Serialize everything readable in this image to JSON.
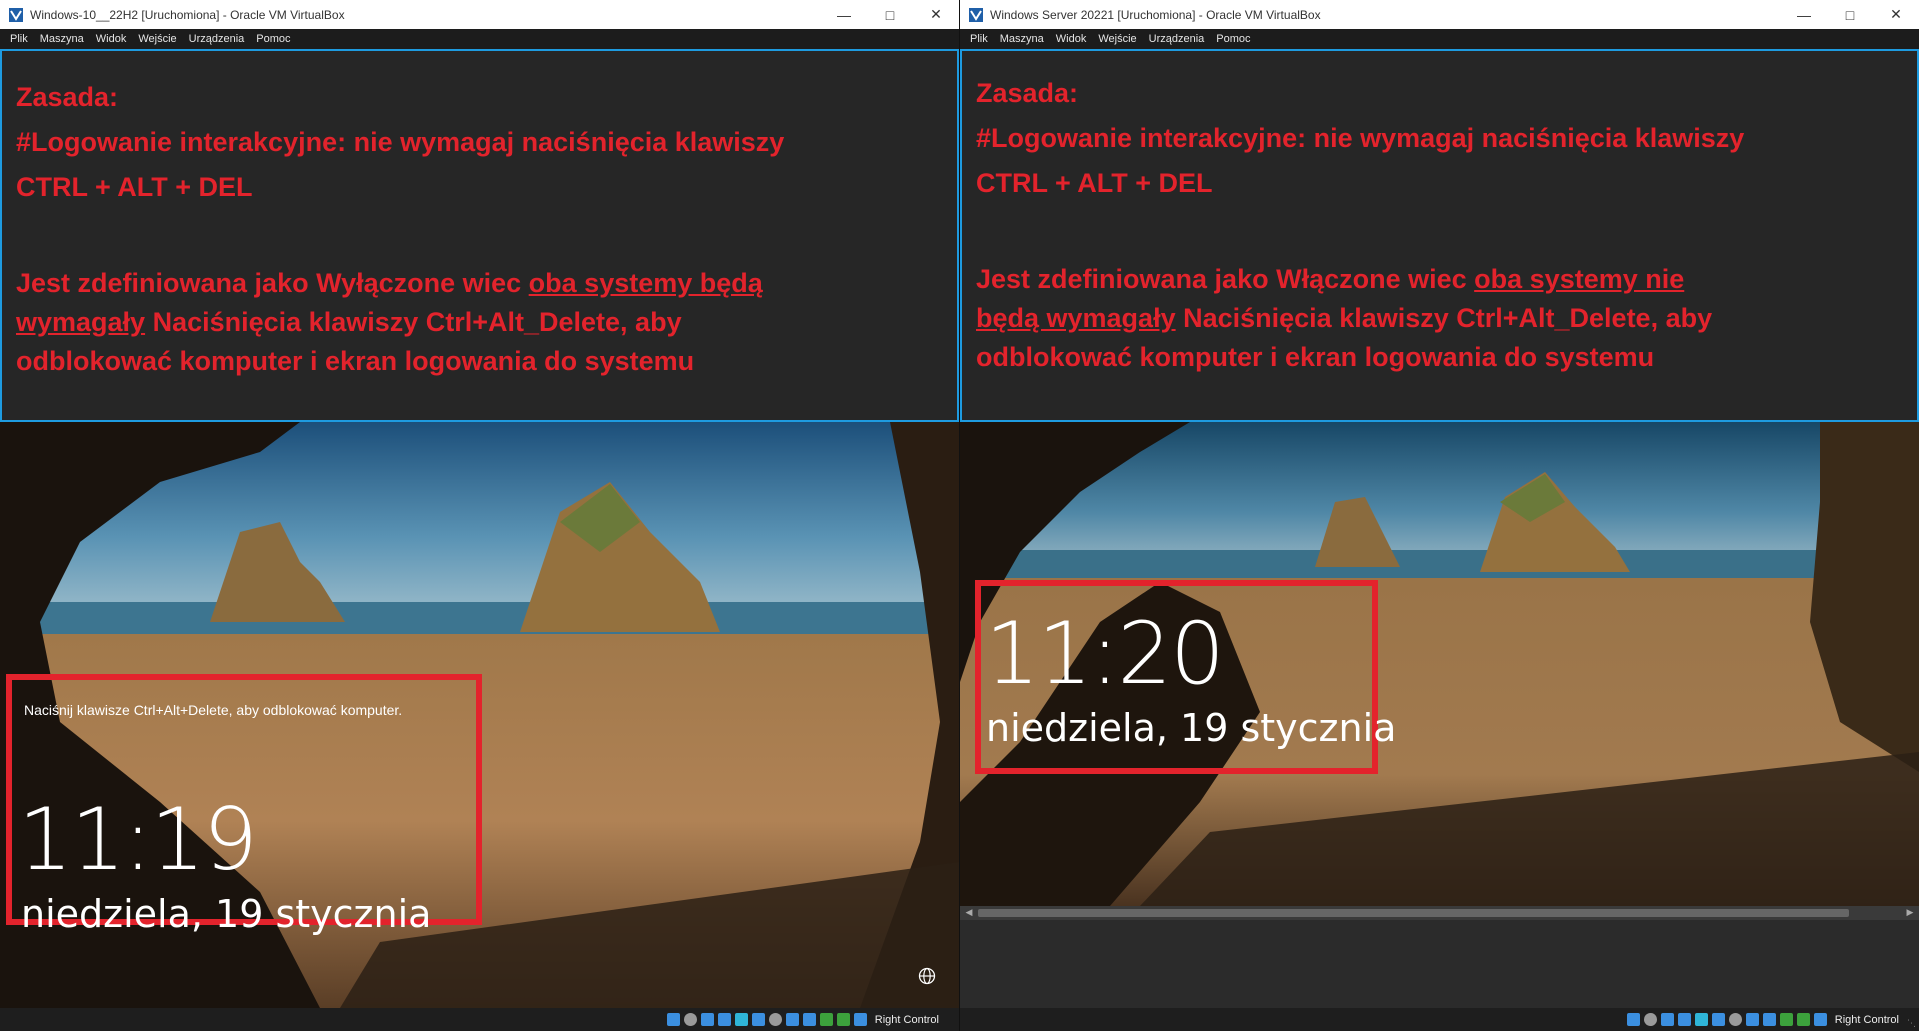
{
  "left": {
    "title": "Windows-10__22H2 [Uruchomiona] - Oracle VM VirtualBox",
    "menu": [
      "Plik",
      "Maszyna",
      "Widok",
      "Wejście",
      "Urządzenia",
      "Pomoc"
    ],
    "note": {
      "line1": "Zasada:",
      "line2": "#Logowanie interakcyjne: nie wymagaj naciśnięcia klawiszy",
      "line3": "CTRL + ALT + DEL",
      "para_pre": "Jest zdefiniowana jako Wyłączone wiec ",
      "para_u1": "oba systemy będą",
      "para_u2": "wymagały",
      "para_post1": " Naciśnięcia klawiszy Ctrl+Alt_Delete, aby",
      "para_post2": "odblokować komputer i ekran logowania do systemu"
    },
    "lock": {
      "hint": "Naciśnij klawisze Ctrl+Alt+Delete, aby odblokować komputer.",
      "time": "11:19",
      "date": "niedziela, 19 stycznia"
    },
    "hostkey": "Right Control"
  },
  "right": {
    "title": "Windows Server 20221 [Uruchomiona] - Oracle VM VirtualBox",
    "menu": [
      "Plik",
      "Maszyna",
      "Widok",
      "Wejście",
      "Urządzenia",
      "Pomoc"
    ],
    "note": {
      "line1": "Zasada:",
      "line2": "#Logowanie interakcyjne: nie wymagaj naciśnięcia klawiszy",
      "line3": "CTRL + ALT + DEL",
      "para_pre": "Jest zdefiniowana jako Włączone wiec ",
      "para_u1": "oba systemy nie",
      "para_u2": "będą wymagały",
      "para_post1": " Naciśnięcia klawiszy Ctrl+Alt_Delete, aby",
      "para_post2": "odblokować komputer i ekran logowania do systemu"
    },
    "lock": {
      "time": "11:20",
      "date": "niedziela, 19 stycznia"
    },
    "hostkey": "Right Control"
  },
  "colors": {
    "accent_red": "#e3232c",
    "frame_blue": "#1e9be0"
  },
  "icons": [
    "virtualbox-icon",
    "minimize-icon",
    "maximize-icon",
    "close-icon",
    "globe-icon",
    "status-icons"
  ]
}
